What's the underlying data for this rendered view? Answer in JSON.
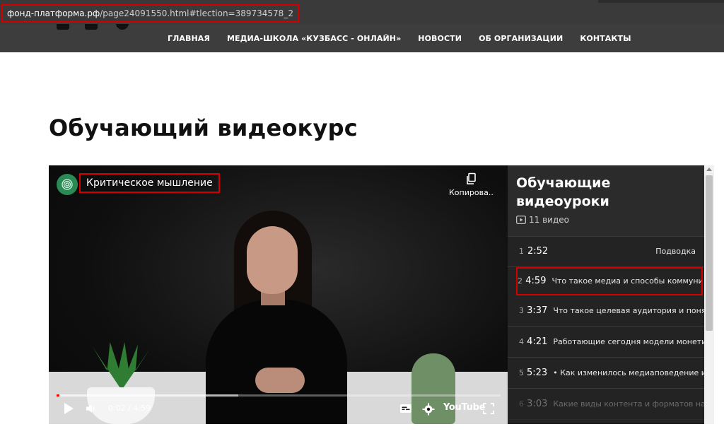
{
  "browser": {
    "url_host": "фонд-платформа.рф",
    "url_path": "/page24091550.html#tlection=389734578_2"
  },
  "header": {
    "social_icons": [
      "vk-icon",
      "youtube-icon",
      "telegram-icon"
    ],
    "nav": [
      {
        "label": "ГЛАВНАЯ"
      },
      {
        "label": "МЕДИА-ШКОЛА «КУЗБАСС - ОНЛАЙН»"
      },
      {
        "label": "НОВОСТИ"
      },
      {
        "label": "ОБ ОРГАНИЗАЦИИ"
      },
      {
        "label": "КОНТАКТЫ"
      }
    ]
  },
  "page": {
    "title": "Обучающий видеокурс"
  },
  "video": {
    "title": "Критическое мышление",
    "copy_label": "Копирова...",
    "time_current": "0:02",
    "time_total": "4:59",
    "time_display": "0:02 / 4:59",
    "progress_fraction": 0.0067,
    "buffered_fraction": 0.41,
    "youtube_label": "YouTube"
  },
  "playlist": {
    "title_line1": "Обучающие",
    "title_line2": "видеоуроки",
    "count": "11 видео",
    "items": [
      {
        "index": "1",
        "duration": "2:52",
        "title": "Подводка"
      },
      {
        "index": "2",
        "duration": "4:59",
        "title": "Что такое медиа и способы коммуника"
      },
      {
        "index": "3",
        "duration": "3:37",
        "title": "Что такое целевая аудитория и поняти"
      },
      {
        "index": "4",
        "duration": "4:21",
        "title": "Работающие сегодня модели монетиза"
      },
      {
        "index": "5",
        "duration": "5:23",
        "title": "• Как изменилось медиаповедение и чт"
      },
      {
        "index": "6",
        "duration": "3:03",
        "title": "Какие виды контента и форматов наиб"
      }
    ]
  },
  "colors": {
    "highlight_box": "#d40000",
    "header_bg": "#3d3d3d",
    "playlist_bg": "#232323",
    "avatar_green": "#2a8a55"
  }
}
